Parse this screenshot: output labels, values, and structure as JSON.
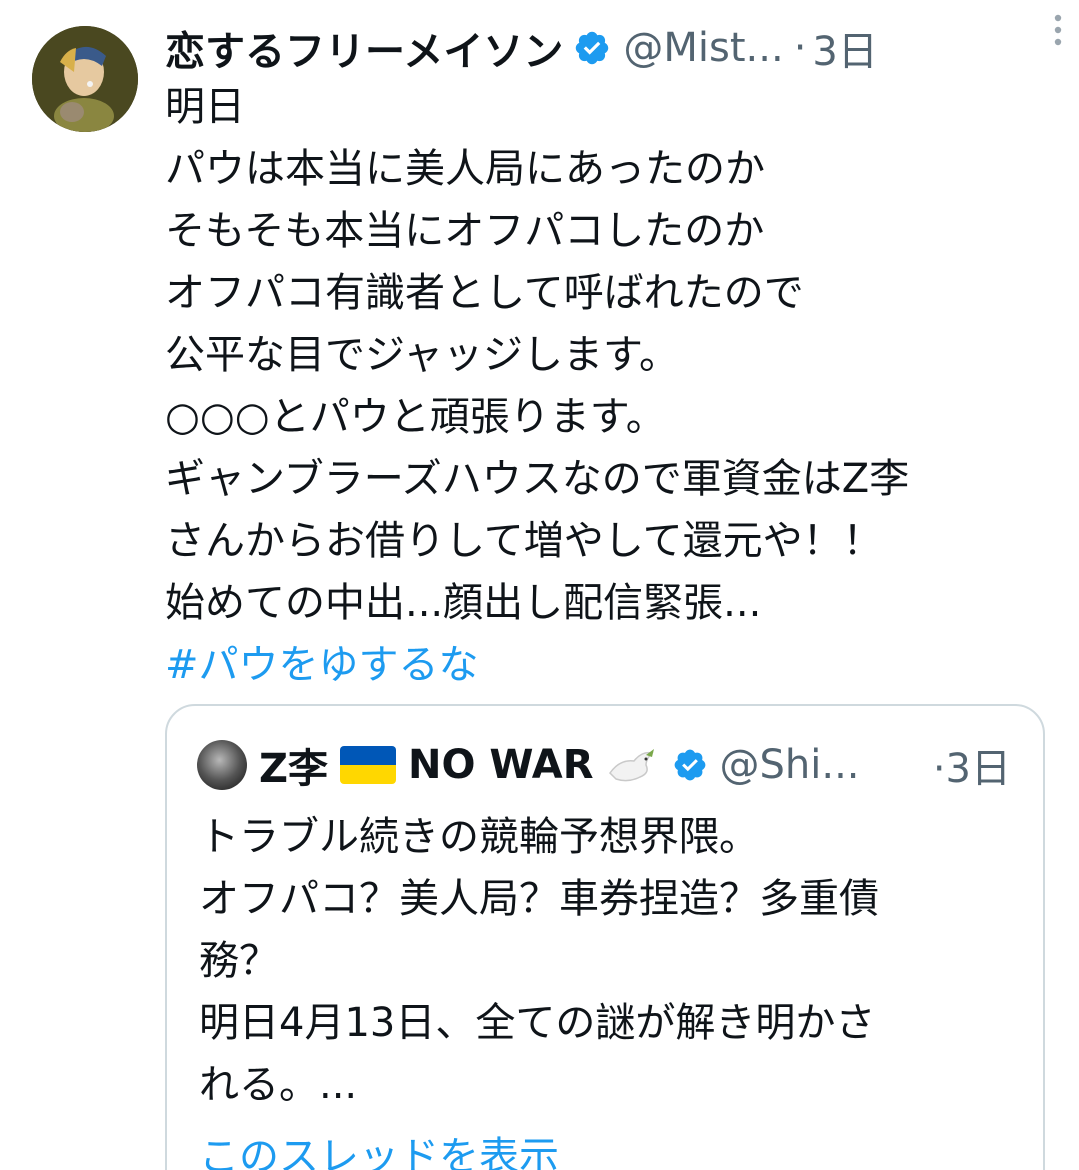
{
  "author": {
    "display_name": "恋するフリーメイソン",
    "handle": "@Mist...",
    "separator": "·",
    "time": "3日",
    "avatar_icon": "avatar-painting",
    "verified_icon": "verified-badge-icon"
  },
  "tweet": {
    "lines": [
      "明日",
      "パウは本当に美人局にあったのか",
      "そもそも本当にオフパコしたのか",
      "オフパコ有識者として呼ばれたので",
      "公平な目でジャッジします。",
      "○○○とパウと頑張ります。",
      "ギャンブラーズハウスなので軍資金はZ李",
      "さんからお借りして増やして還元や！！",
      "始めての中出...顔出し配信緊張..."
    ],
    "hashtag": "#パウをゆするな"
  },
  "quote": {
    "display_name_prefix": "Z李",
    "display_name_suffix": "NO WAR",
    "flag_icon": "ukraine-flag-icon",
    "dove_icon": "dove-icon",
    "handle": "@Shi...",
    "separator": "·",
    "time": "3日",
    "lines": [
      "トラブル続きの競輪予想界隈。",
      "オフパコ？美人局？車券捏造？多重債",
      "務？",
      "明日4月13日、全ての謎が解き明かさ",
      "れる。..."
    ],
    "show_thread": "このスレッドを表示"
  },
  "colors": {
    "link": "#1d9bf0",
    "secondary_text": "#536471",
    "primary_text": "#0f1419",
    "border": "#cfd9de"
  }
}
